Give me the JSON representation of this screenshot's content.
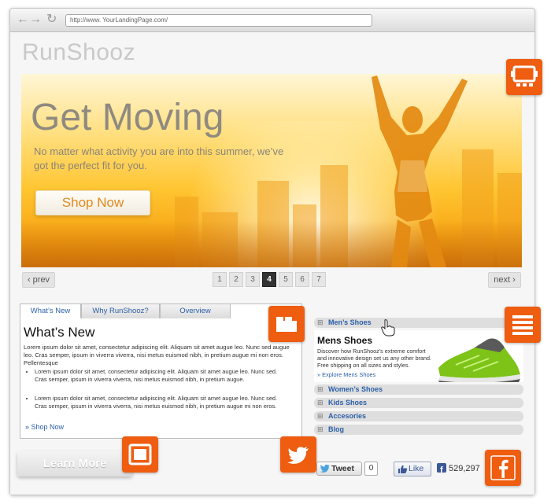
{
  "browser": {
    "url": "http://www. YourLandingPage.com/",
    "back_glyph": "←",
    "forward_glyph": "→",
    "reload_glyph": "↻"
  },
  "logo": "RunShooz",
  "hero": {
    "title": "Get Moving",
    "subtitle": "No matter what activity you are into this summer, we’ve got the perfect fit for you.",
    "cta": "Shop Now"
  },
  "pagination": {
    "prev": "‹ prev",
    "next": "next ›",
    "pages": [
      "1",
      "2",
      "3",
      "4",
      "5",
      "6",
      "7"
    ],
    "active": "4"
  },
  "tabs": {
    "items": [
      "What’s New",
      "Why RunShooz?",
      "Overview"
    ],
    "active": "What’s New",
    "heading": "What’s New",
    "intro": "Lorem ipsum dolor sit amet, consectetur adipiscing elit. Aliquam sit amet augue leo. Nunc sed augue leo. Cras semper, ipsum in viverra viverra, nisi metus euismod nibh, in pretium augue mi non eros. Pellentesque",
    "bullets": [
      "Lorem ipsum dolor sit amet, consectetur adipiscing elit. Aliquam sit amet augue leo. Nunc sed. Cras semper, ipsum in viverra viverra, nisi metus euismod nibh, in pretium augue.",
      "Lorem ipsum dolor sit amet, consectetur adipiscing elit. Aliquam sit amet augue leo. Nunc sed. Cras semper, ipsum in viverra viverra, nisi metus euismod nibh, in pretium augue mi non eros."
    ],
    "link": "» Shop Now"
  },
  "learn_more": "Learn More",
  "accordion": {
    "plus_glyph": "⊞",
    "items": [
      "Men’s Shoes",
      "Women’s Shoes",
      "Kids Shoes",
      "Accesories",
      "Blog"
    ],
    "open": {
      "heading": "Mens Shoes",
      "text": "Discover how RunShooz’s extreme comfort and innovative design set us any other brand. Free shipping on all sizes and styles.",
      "link": "» Explore Mens Shoes"
    }
  },
  "social": {
    "tweet_label": "Tweet",
    "tweet_count": "0",
    "like_label": "Like",
    "fb_count": "529,297"
  },
  "colors": {
    "accent_orange": "#ee5d10",
    "link_blue": "#2a5fa8"
  },
  "icons": [
    "slideshow-icon",
    "tabs-icon",
    "accordion-icon",
    "button-icon",
    "twitter-icon",
    "facebook-icon",
    "hand-cursor-icon"
  ]
}
